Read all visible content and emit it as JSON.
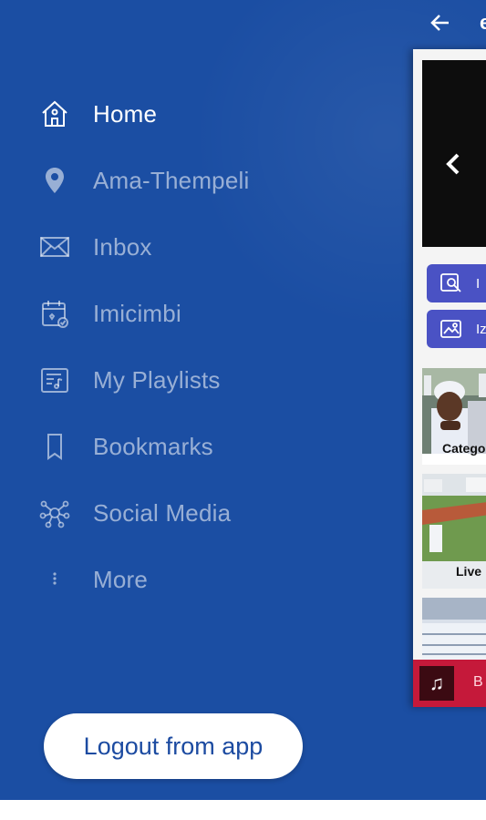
{
  "menu": {
    "items": [
      {
        "label": "Home",
        "icon": "home-icon",
        "active": true
      },
      {
        "label": "Ama-Thempeli",
        "icon": "location-pin-icon",
        "active": false
      },
      {
        "label": "Inbox",
        "icon": "mail-icon",
        "active": false
      },
      {
        "label": "Imicimbi",
        "icon": "calendar-icon",
        "active": false
      },
      {
        "label": "My Playlists",
        "icon": "playlist-icon",
        "active": false
      },
      {
        "label": "Bookmarks",
        "icon": "bookmark-icon",
        "active": false
      },
      {
        "label": "Social Media",
        "icon": "social-network-icon",
        "active": false
      },
      {
        "label": "More",
        "icon": "more-vertical-icon",
        "active": false
      }
    ]
  },
  "logout_label": "Logout from app",
  "background": {
    "title_partial": "e",
    "pills": [
      {
        "label": "I",
        "icon": "search-image-icon"
      },
      {
        "label": "Iz",
        "icon": "photo-gallery-icon"
      }
    ],
    "tiles": [
      {
        "label": "Categor"
      },
      {
        "label": "Live"
      }
    ],
    "player": {
      "text": "B",
      "icon": "music-note-icon"
    }
  },
  "colors": {
    "drawer_bg": "#1b4ea3",
    "logout_text": "#1c4ba1",
    "pill_bg": "#4a52c4",
    "player_bg": "#c5193a"
  }
}
